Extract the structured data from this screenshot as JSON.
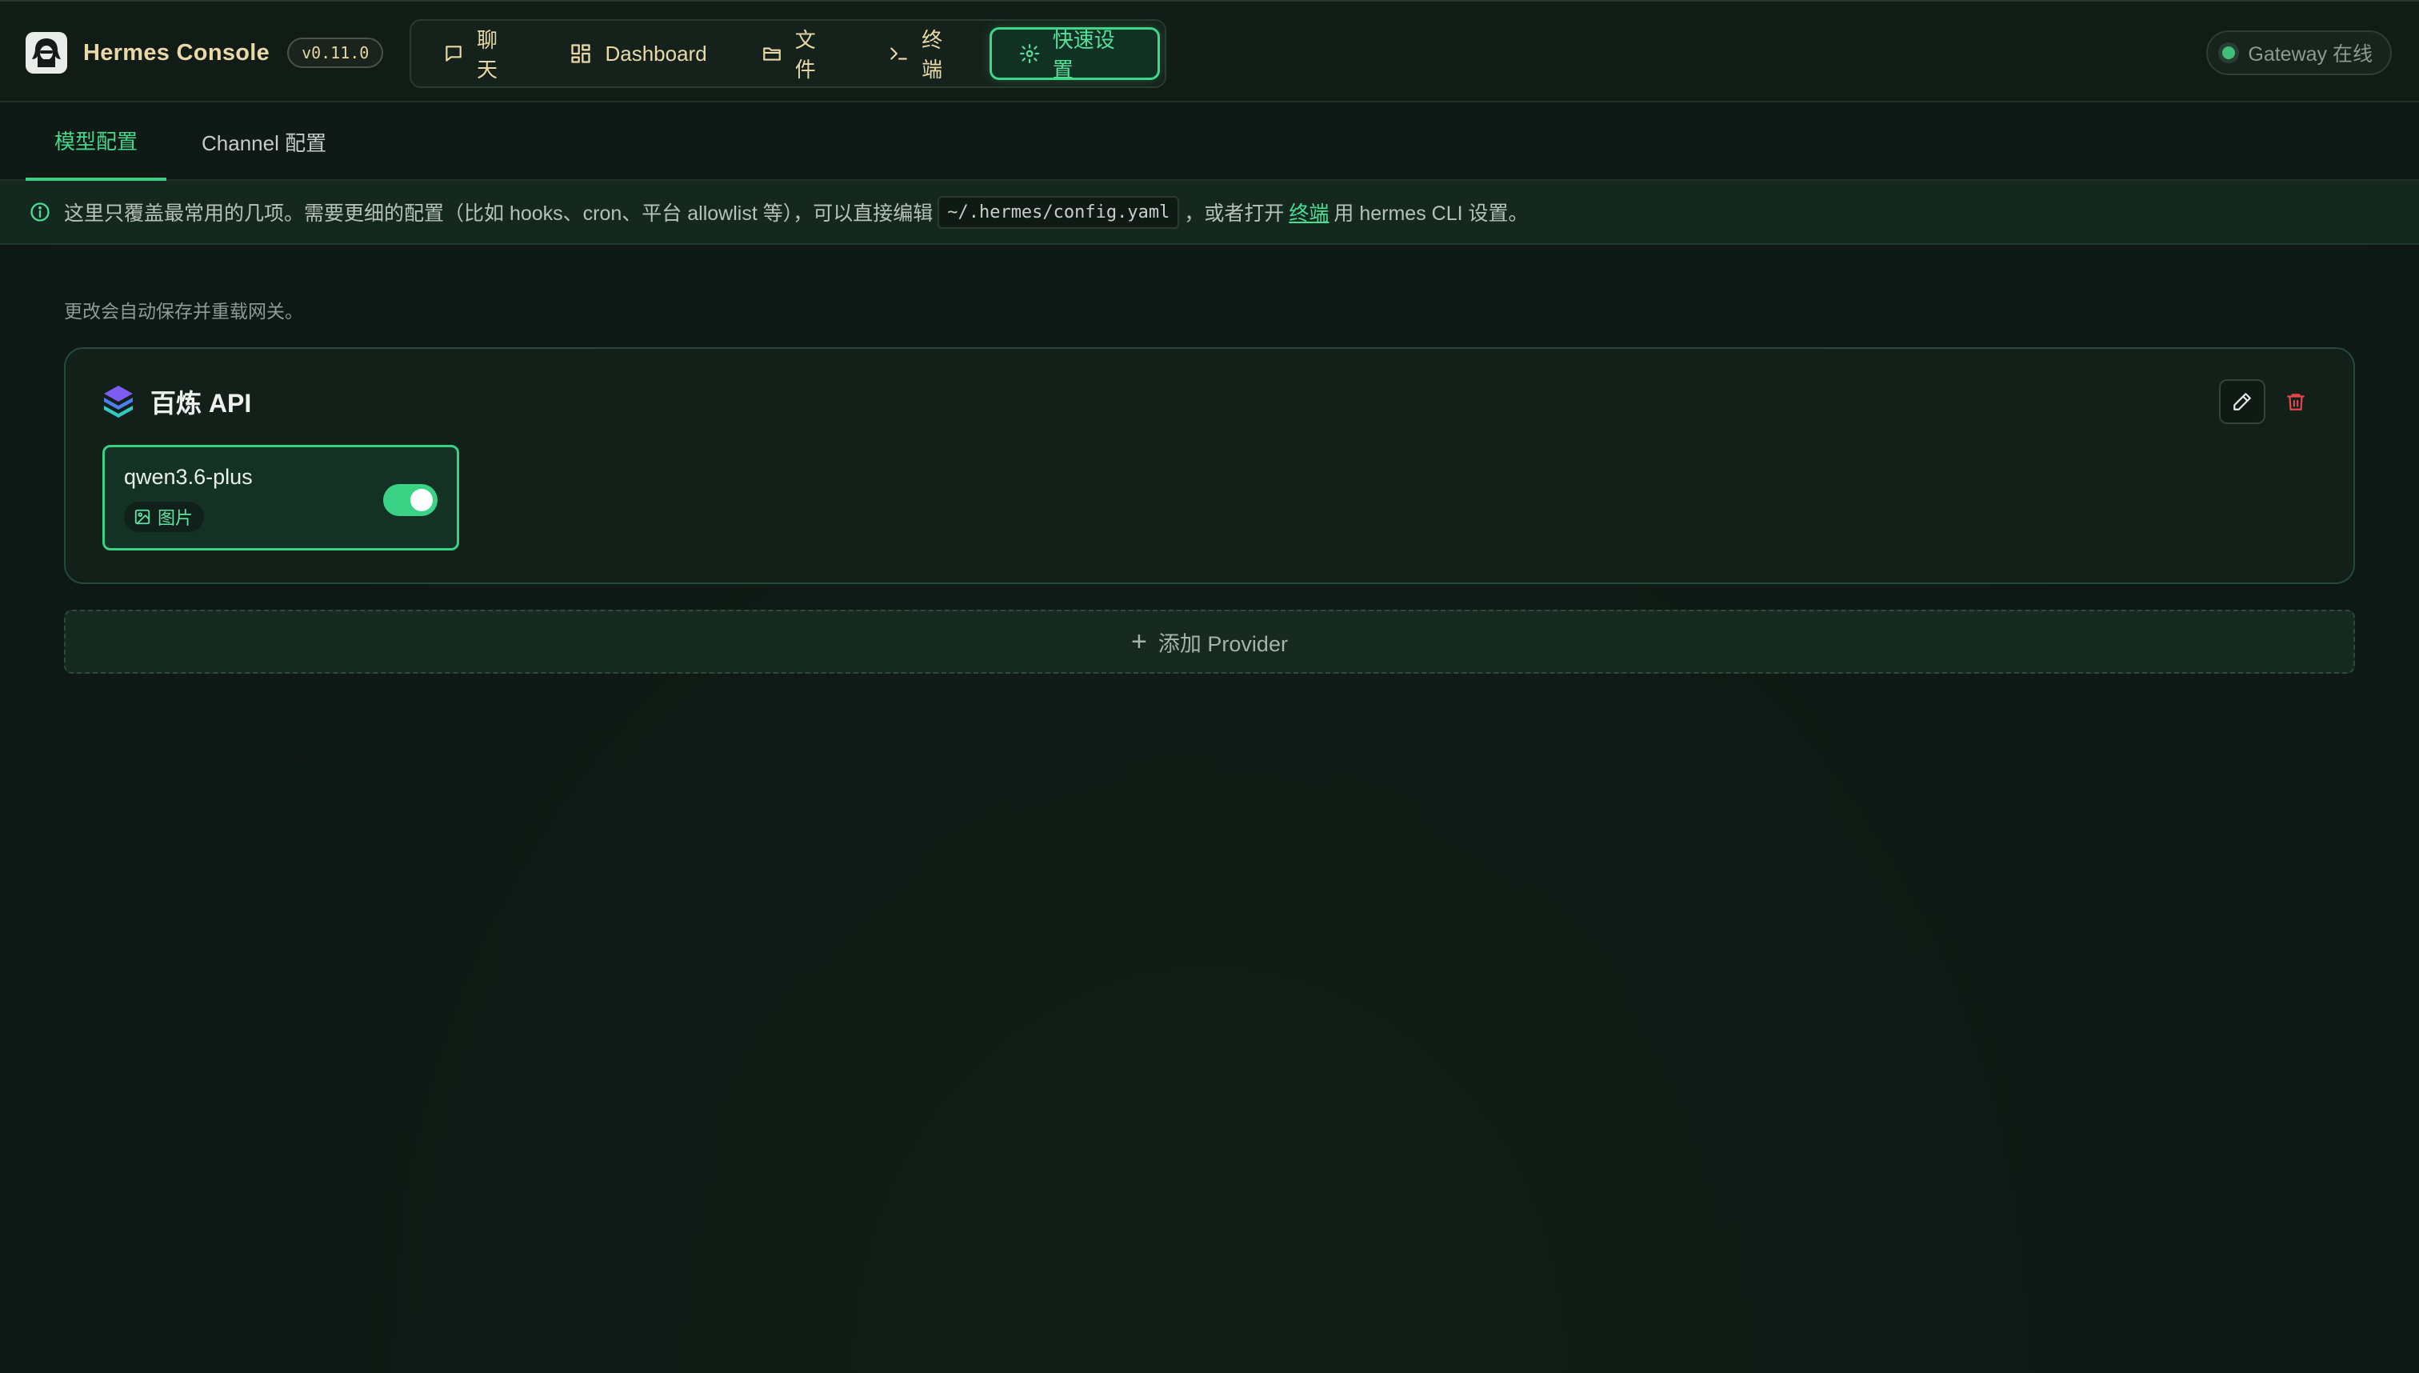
{
  "header": {
    "app_title": "Hermes Console",
    "version": "v0.11.0",
    "nav": [
      {
        "label": "聊天",
        "icon": "chat-icon"
      },
      {
        "label": "Dashboard",
        "icon": "dashboard-icon"
      },
      {
        "label": "文件",
        "icon": "folder-icon"
      },
      {
        "label": "终端",
        "icon": "terminal-icon"
      },
      {
        "label": "快速设置",
        "icon": "gear-icon",
        "active": true
      }
    ],
    "gateway_status": "Gateway 在线"
  },
  "tabs": [
    {
      "label": "模型配置",
      "active": true
    },
    {
      "label": "Channel 配置",
      "active": false
    }
  ],
  "banner": {
    "text_before_code": "这里只覆盖最常用的几项。需要更细的配置（比如 hooks、cron、平台 allowlist 等），可以直接编辑",
    "code": "~/.hermes/config.yaml",
    "text_middle": "，或者打开",
    "link": "终端",
    "text_after": "用 hermes CLI 设置。"
  },
  "main": {
    "note": "更改会自动保存并重载网关。",
    "providers": [
      {
        "name": "百炼 API",
        "models": [
          {
            "name": "qwen3.6-plus",
            "capability": "图片",
            "enabled": true
          }
        ]
      }
    ],
    "add_provider_label": "添加 Provider"
  },
  "colors": {
    "accent": "#3ed788",
    "background": "#0f1915",
    "brand_text": "#ead9a8",
    "danger": "#e5484d"
  }
}
